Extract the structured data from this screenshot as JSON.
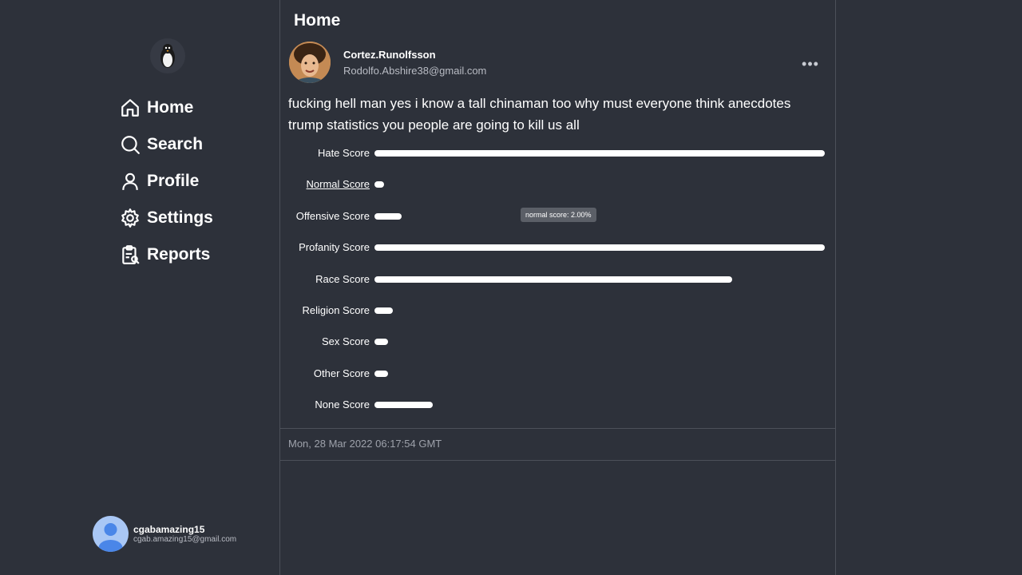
{
  "sidebar": {
    "logo": "penguin-logo",
    "items": [
      {
        "label": "Home",
        "icon": "home-icon"
      },
      {
        "label": "Search",
        "icon": "search-icon"
      },
      {
        "label": "Profile",
        "icon": "profile-icon"
      },
      {
        "label": "Settings",
        "icon": "gear-icon"
      },
      {
        "label": "Reports",
        "icon": "reports-icon"
      }
    ],
    "user": {
      "name": "cgabamazing15",
      "email": "cgab.amazing15@gmail.com"
    }
  },
  "main": {
    "title": "Home",
    "post": {
      "author_name": "Cortez.Runolfsson",
      "author_email": "Rodolfo.Abshire38@gmail.com",
      "more_label": "•••",
      "text": "fucking hell man yes i know a tall chinaman too why must everyone think anecdotes trump statistics you people are going to kill us all",
      "scores": [
        {
          "label": "Hate Score",
          "value": 1.0
        },
        {
          "label": "Normal Score",
          "value": 0.02
        },
        {
          "label": "Offensive Score",
          "value": 0.06
        },
        {
          "label": "Profanity Score",
          "value": 1.0
        },
        {
          "label": "Race Score",
          "value": 0.795
        },
        {
          "label": "Religion Score",
          "value": 0.04
        },
        {
          "label": "Sex Score",
          "value": 0.03
        },
        {
          "label": "Other Score",
          "value": 0.03
        },
        {
          "label": "None Score",
          "value": 0.13
        }
      ],
      "tooltip": "normal score: 2.00%",
      "timestamp": "Mon, 28 Mar 2022 06:17:54 GMT"
    }
  },
  "colors": {
    "background": "#2d313a",
    "bar": "#ffffff",
    "border": "#4c5059",
    "muted_text": "#9ea2ab"
  }
}
